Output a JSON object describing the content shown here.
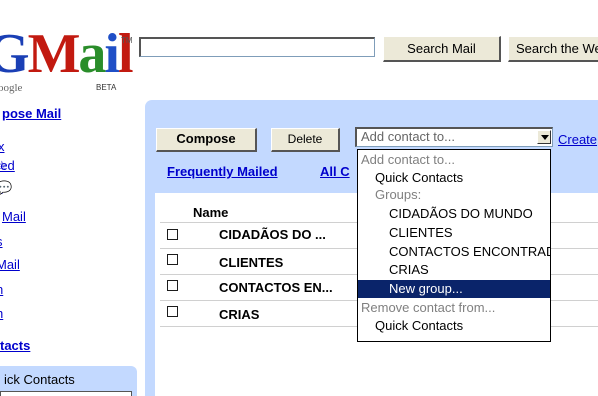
{
  "logo": {
    "parts": [
      "G",
      "M",
      "a",
      "i",
      "l"
    ],
    "tm": "TM",
    "google": "oogle",
    "beta": "BETA"
  },
  "header": {
    "search_placeholder": "",
    "search_mail_label": "Search Mail",
    "search_web_label": "Search the Web"
  },
  "sidebar": {
    "compose_label": "pose Mail",
    "items": [
      "x",
      "red",
      "s",
      "Mail",
      "s",
      "Mail",
      "n",
      "h"
    ],
    "contacts_label": "tacts",
    "quick_contacts_label": "ick Contacts"
  },
  "toolbar": {
    "compose_label": "Compose",
    "delete_label": "Delete",
    "add_contact_placeholder": "Add contact to...",
    "create_label": "Create"
  },
  "tabs": {
    "frequently_mailed": "Frequently Mailed",
    "all_contacts": "All C"
  },
  "contacts": {
    "name_header": "Name",
    "rows": [
      "CIDADÃOS DO ...",
      "CLIENTES",
      "CONTACTOS EN...",
      "CRIAS"
    ]
  },
  "dropdown": {
    "options": [
      {
        "label": "Add contact to...",
        "kind": "header"
      },
      {
        "label": "Quick Contacts",
        "kind": "l1"
      },
      {
        "label": "Groups:",
        "kind": "header2"
      },
      {
        "label": "CIDADÃOS DO MUNDO",
        "kind": "l2"
      },
      {
        "label": "CLIENTES",
        "kind": "l2"
      },
      {
        "label": "CONTACTOS ENCONTRADOS",
        "kind": "l2"
      },
      {
        "label": "CRIAS",
        "kind": "l2"
      },
      {
        "label": "New group...",
        "kind": "l2 sel"
      },
      {
        "label": "Remove contact from...",
        "kind": "header"
      },
      {
        "label": "Quick Contacts",
        "kind": "l1"
      }
    ]
  },
  "colors": {
    "panel": "#c3d9ff",
    "link": "#0000cc",
    "selected": "#0a246a",
    "frame": "#edf5e3"
  }
}
